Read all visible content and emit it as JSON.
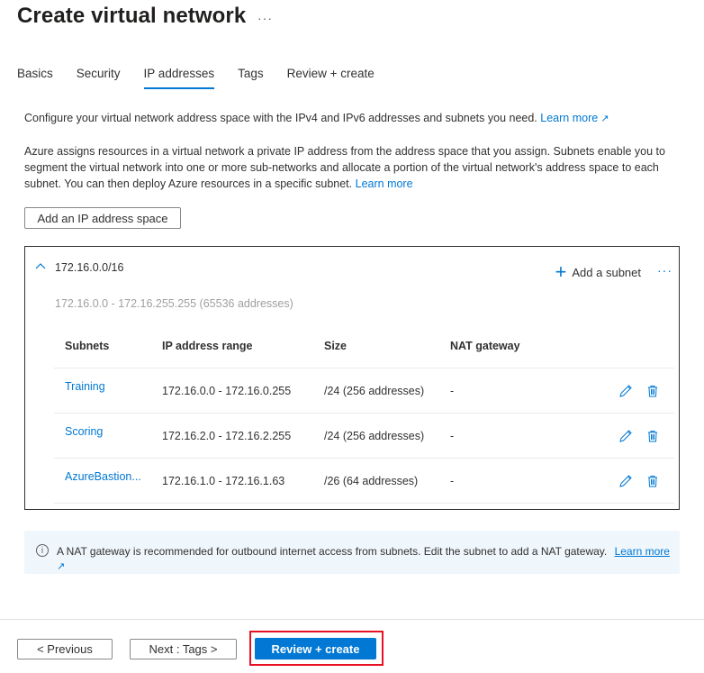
{
  "header": {
    "title": "Create virtual network",
    "more_label": "···"
  },
  "tabs": [
    {
      "label": "Basics",
      "active": false
    },
    {
      "label": "Security",
      "active": false
    },
    {
      "label": "IP addresses",
      "active": true
    },
    {
      "label": "Tags",
      "active": false
    },
    {
      "label": "Review + create",
      "active": false
    }
  ],
  "intro": {
    "text": "Configure your virtual network address space with the IPv4 and IPv6 addresses and subnets you need.",
    "link": "Learn more",
    "ext_icon": "↗"
  },
  "description": {
    "text": "Azure assigns resources in a virtual network a private IP address from the address space that you assign. Subnets enable you to segment the virtual network into one or more sub-networks and allocate a portion of the virtual network's address space to each subnet. You can then deploy Azure resources in a specific subnet.",
    "link": "Learn more"
  },
  "add_space_button": "Add an IP address space",
  "address_space": {
    "cidr": "172.16.0.0/16",
    "range": "172.16.0.0 - 172.16.255.255 (65536 addresses)",
    "add_subnet_label": "Add a subnet",
    "more_label": "···",
    "columns": [
      "Subnets",
      "IP address range",
      "Size",
      "NAT gateway"
    ],
    "rows": [
      {
        "name": "Training",
        "range": "172.16.0.0 - 172.16.0.255",
        "size": "/24 (256 addresses)",
        "nat": "-"
      },
      {
        "name": "Scoring",
        "range": "172.16.2.0 - 172.16.2.255",
        "size": "/24 (256 addresses)",
        "nat": "-"
      },
      {
        "name": "AzureBastion...",
        "range": "172.16.1.0 - 172.16.1.63",
        "size": "/26 (64 addresses)",
        "nat": "-"
      }
    ]
  },
  "info_banner": {
    "icon": "i",
    "text": "A NAT gateway is recommended for outbound internet access from subnets. Edit the subnet to add a NAT gateway.",
    "link": "Learn more",
    "ext_icon": "↗"
  },
  "footer": {
    "previous": "< Previous",
    "next": "Next : Tags >",
    "review_create": "Review + create"
  },
  "colors": {
    "accent": "#0078d4",
    "highlight": "#e81123",
    "info_bg": "#eff6fc"
  }
}
